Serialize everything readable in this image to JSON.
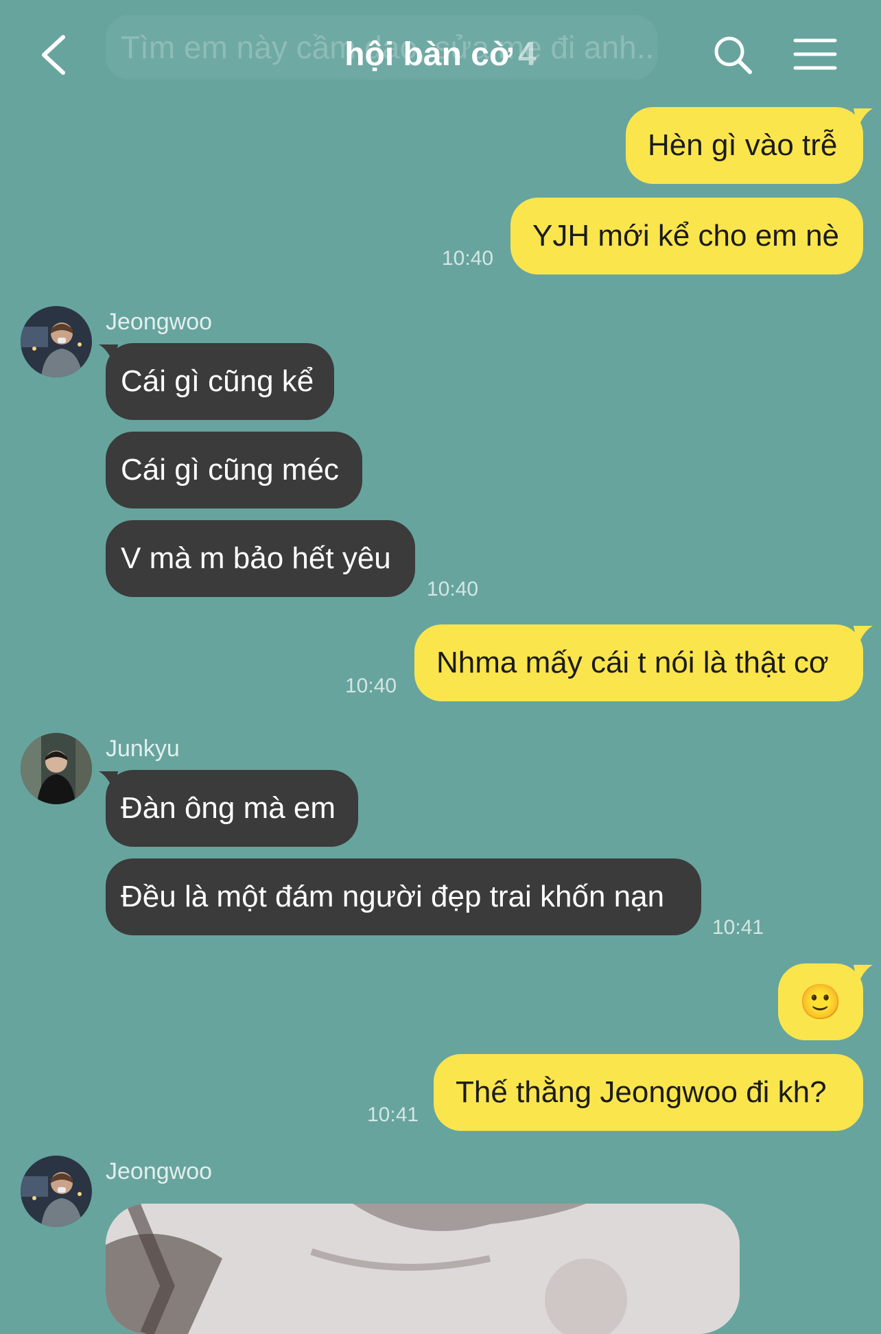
{
  "header": {
    "ghost_preview": "Tìm em này cầm dao, sửa mẹ đi anh...",
    "title": "hội bàn cờ",
    "member_count": "4",
    "icons": {
      "back": "back-chevron-icon",
      "search": "search-icon",
      "menu": "hamburger-menu-icon"
    }
  },
  "messages": [
    {
      "text": "Hèn gì vào trễ"
    },
    {
      "text": "YJH mới kể cho em nè",
      "time": "10:40"
    },
    {
      "sender": "Jeongwoo"
    },
    {
      "text": "Cái gì cũng kể"
    },
    {
      "text": "Cái gì cũng méc"
    },
    {
      "text": "V mà m bảo hết yêu",
      "time": "10:40"
    },
    {
      "text": "Nhma mấy cái t nói là thật cơ",
      "time": "10:40"
    },
    {
      "sender": "Junkyu"
    },
    {
      "text": "Đàn ông mà em"
    },
    {
      "text": "Đều là một đám người đẹp trai khốn nạn",
      "time": "10:41"
    },
    {
      "text": "🙂"
    },
    {
      "text": "Thế thằng Jeongwoo đi kh?",
      "time": "10:41"
    },
    {
      "sender": "Jeongwoo"
    }
  ],
  "colors": {
    "background": "#67a49e",
    "outgoing_bubble": "#fae54d",
    "incoming_bubble": "#3a3b3a"
  }
}
